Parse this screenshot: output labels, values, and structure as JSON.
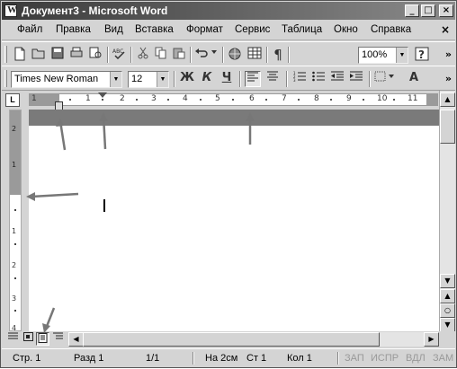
{
  "window": {
    "title": "Документ3 - Microsoft Word"
  },
  "window_controls": {
    "minimize": "_",
    "maximize": "□",
    "close": "×"
  },
  "menu": {
    "items": [
      "Файл",
      "Правка",
      "Вид",
      "Вставка",
      "Формат",
      "Сервис",
      "Таблица",
      "Окно",
      "Справка"
    ],
    "close_glyph": "×"
  },
  "standard_toolbar": {
    "icons": [
      "new-document-icon",
      "open-folder-icon",
      "save-icon",
      "print-preview-icon",
      "print-icon",
      "spell-check-icon",
      "cut-icon",
      "copy-icon",
      "paste-icon",
      "undo-icon",
      "web-icon",
      "table-icon",
      "pilcrow-icon",
      "help-icon"
    ],
    "zoom": "100%",
    "overflow": "»"
  },
  "formatting_toolbar": {
    "font_name": "Times New Roman",
    "font_size": "12",
    "bold": "Ж",
    "italic": "К",
    "underline": "Ч",
    "font_color_label": "A",
    "overflow": "»"
  },
  "ruler": {
    "corner": "L",
    "numbers": [
      "1",
      "1",
      "2",
      "3",
      "4",
      "5",
      "6",
      "7",
      "8",
      "9",
      "10",
      "11"
    ]
  },
  "vertical_ruler": {
    "numbers": [
      "2",
      "1",
      "1",
      "2",
      "3",
      "4"
    ]
  },
  "status_bar": {
    "page": "Стр. 1",
    "section": "Разд 1",
    "pages": "1/1",
    "at": "На 2см",
    "line": "Ст 1",
    "column": "Кол 1",
    "rec": "ЗАП",
    "trk": "ИСПР",
    "ext": "ВДЛ",
    "ovr": "ЗАМ"
  }
}
